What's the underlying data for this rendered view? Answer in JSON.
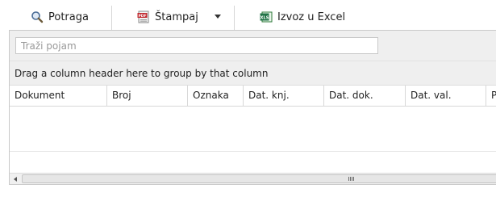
{
  "toolbar": {
    "search_label": "Potraga",
    "print_label": "Štampaj",
    "export_label": "Izvoz u Excel"
  },
  "grid": {
    "search_placeholder": "Traži pojam",
    "group_panel_text": "Drag a column header here to group by that column",
    "columns": [
      "Dokument",
      "Broj",
      "Oznaka",
      "Dat. knj.",
      "Dat. dok.",
      "Dat. val.",
      "P"
    ]
  },
  "colors": {
    "toolbar_bg": "#ffffff",
    "panel_bg": "#efefef",
    "border": "#c9c9c9"
  }
}
